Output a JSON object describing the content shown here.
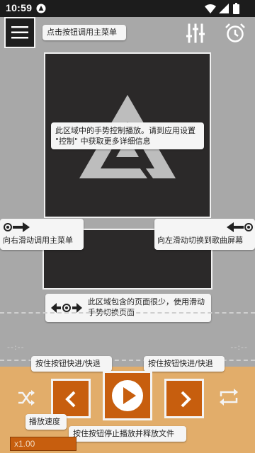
{
  "status_bar": {
    "time": "10:59",
    "icons": [
      "notification-app-icon",
      "wifi-icon",
      "cell-signal-icon",
      "battery-icon"
    ]
  },
  "toolbar": {
    "menu_icon": "hamburger-menu-icon",
    "equalizer_icon": "equalizer-sliders-icon",
    "timer_icon": "alarm-clock-icon"
  },
  "tips": {
    "menu_button": "点击按钮调用主菜单",
    "gesture_area": "此区域中的手势控制播放。请到应用设置 \"控制\" 中获取更多详细信息",
    "swipe_right": "向右滑动调用主菜单",
    "swipe_left": "向左滑动切换到歌曲屏幕",
    "page_switch": "此区域包含的页面很少，使用滑动手势切换页面",
    "prev_button": "按住按钮快进/快退",
    "next_button": "按住按钮快进/快退",
    "play_button": "按住按钮停止播放并释放文件",
    "speed": "播放速度"
  },
  "player": {
    "time_placeholder": "--:--",
    "speed_value": "x1.00",
    "colors": {
      "accent": "#c75e0e",
      "panel": "#e2ad6a",
      "background": "#a8a8a8"
    }
  }
}
